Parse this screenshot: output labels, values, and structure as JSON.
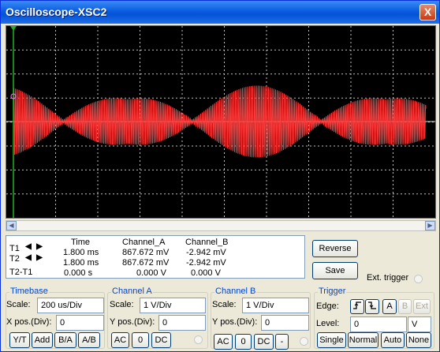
{
  "window": {
    "title": "Oscilloscope-XSC2",
    "close_label": "X"
  },
  "colors": {
    "trace": "#ff3b3b",
    "screen_bg": "#000000",
    "grid": "#bfbfbf",
    "cursor": "#1db31d",
    "accent": "#0046d5"
  },
  "readout": {
    "headers": {
      "time": "Time",
      "channel_a": "Channel_A",
      "channel_b": "Channel_B"
    },
    "rows": [
      {
        "label": "T1",
        "time": "1.800 ms",
        "channel_a": "867.672 mV",
        "channel_b": "-2.942 mV"
      },
      {
        "label": "T2",
        "time": "1.800 ms",
        "channel_a": "867.672 mV",
        "channel_b": "-2.942 mV"
      },
      {
        "label": "T2-T1",
        "time": "0.000 s",
        "channel_a": "0.000 V",
        "channel_b": "0.000 V"
      }
    ],
    "reverse_label": "Reverse",
    "save_label": "Save",
    "ext_trigger_label": "Ext. trigger"
  },
  "timebase": {
    "title": "Timebase",
    "scale_label": "Scale:",
    "scale_value": "200 us/Div",
    "xpos_label": "X pos.(Div):",
    "xpos_value": "0",
    "buttons": [
      "Y/T",
      "Add",
      "B/A",
      "A/B"
    ]
  },
  "channel_a": {
    "title": "Channel A",
    "scale_label": "Scale:",
    "scale_value": "1  V/Div",
    "ypos_label": "Y pos.(Div):",
    "ypos_value": "0",
    "buttons": [
      "AC",
      "0",
      "DC"
    ]
  },
  "channel_b": {
    "title": "Channel B",
    "scale_label": "Scale:",
    "scale_value": "1  V/Div",
    "ypos_label": "Y pos.(Div):",
    "ypos_value": "0",
    "buttons": [
      "AC",
      "0",
      "DC",
      "-"
    ]
  },
  "trigger": {
    "title": "Trigger",
    "edge_label": "Edge:",
    "edge_buttons": [
      "A",
      "B",
      "Ext"
    ],
    "level_label": "Level:",
    "level_value": "0",
    "level_unit": "V",
    "mode_buttons": [
      "Single",
      "Normal",
      "Auto",
      "None"
    ]
  }
}
